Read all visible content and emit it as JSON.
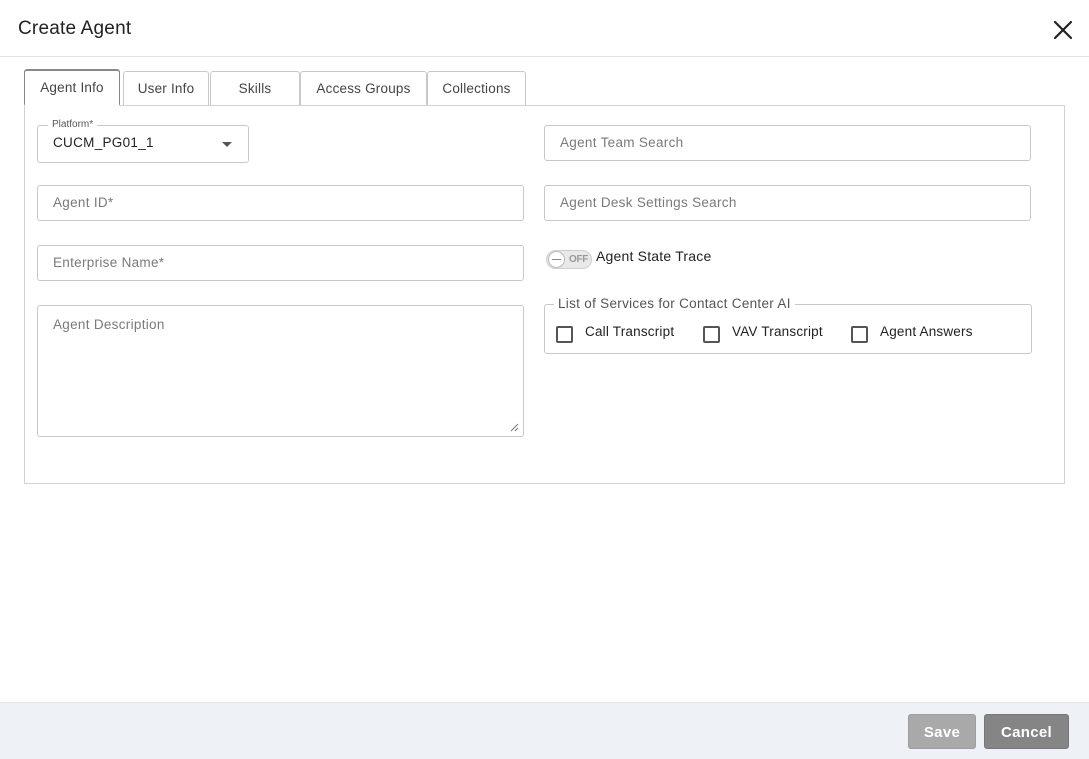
{
  "dialog": {
    "title": "Create Agent",
    "close_icon": "close-icon"
  },
  "tabs": [
    {
      "label": "Agent Info",
      "active": true
    },
    {
      "label": "User Info",
      "active": false
    },
    {
      "label": "Skills",
      "active": false
    },
    {
      "label": "Access Groups",
      "active": false
    },
    {
      "label": "Collections",
      "active": false
    }
  ],
  "form": {
    "platform": {
      "label": "Platform*",
      "value": "CUCM_PG01_1"
    },
    "agent_id": {
      "placeholder": "Agent ID*",
      "value": ""
    },
    "enterprise_name": {
      "placeholder": "Enterprise Name*",
      "value": ""
    },
    "agent_description": {
      "placeholder": "Agent Description",
      "value": ""
    },
    "agent_team_search": {
      "placeholder": "Agent Team Search",
      "value": ""
    },
    "agent_desk_settings_search": {
      "placeholder": "Agent Desk Settings Search",
      "value": ""
    },
    "agent_state_trace": {
      "label": "Agent State Trace",
      "state_text": "OFF",
      "enabled": false
    },
    "services": {
      "legend": "List of Services for Contact Center AI",
      "options": [
        {
          "label": "Call Transcript",
          "checked": false
        },
        {
          "label": "VAV Transcript",
          "checked": false
        },
        {
          "label": "Agent Answers",
          "checked": false
        }
      ]
    }
  },
  "footer": {
    "save_label": "Save",
    "cancel_label": "Cancel"
  },
  "colors": {
    "save_button": "#a9a9a9",
    "cancel_button": "#858585",
    "footer_bg": "#eef1f5"
  }
}
